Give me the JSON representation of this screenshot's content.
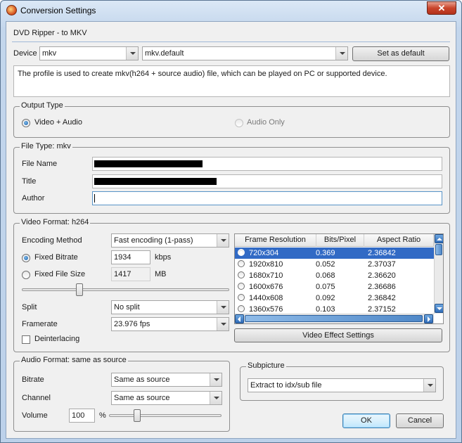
{
  "window": {
    "title": "Conversion Settings",
    "close_glyph": "✕"
  },
  "header": {
    "title": "DVD Ripper - to MKV"
  },
  "device": {
    "label": "Device",
    "device_value": "mkv",
    "profile_value": "mkv.default",
    "set_default_label": "Set as default",
    "description": "The profile is used to create mkv(h264 + source audio) file, which can be played on PC or supported device."
  },
  "output_type": {
    "label": "Output Type",
    "video_audio": "Video + Audio",
    "audio_only": "Audio Only",
    "selected": "Video + Audio"
  },
  "file_type": {
    "label": "File Type: mkv",
    "file_name_label": "File Name",
    "title_label": "Title",
    "author_label": "Author"
  },
  "video": {
    "label": "Video Format: h264",
    "encoding_label": "Encoding Method",
    "encoding_value": "Fast encoding (1-pass)",
    "fixed_bitrate_label": "Fixed Bitrate",
    "bitrate_value": "1934",
    "bitrate_unit": "kbps",
    "fixed_size_label": "Fixed File Size",
    "size_value": "1417",
    "size_unit": "MB",
    "rate_mode": "Fixed Bitrate",
    "quality_slider_fraction": 0.27,
    "split_label": "Split",
    "split_value": "No split",
    "framerate_label": "Framerate",
    "framerate_value": "23.976 fps",
    "deinterlacing_label": "Deinterlacing",
    "deinterlacing_checked": false,
    "effect_settings_label": "Video Effect Settings",
    "table": {
      "headers": [
        "Frame Resolution",
        "Bits/Pixel",
        "Aspect Ratio"
      ],
      "rows": [
        {
          "resolution": "720x304",
          "bits": "0.369",
          "aspect": "2.36842",
          "selected": true
        },
        {
          "resolution": "1920x810",
          "bits": "0.052",
          "aspect": "2.37037",
          "selected": false
        },
        {
          "resolution": "1680x710",
          "bits": "0.068",
          "aspect": "2.36620",
          "selected": false
        },
        {
          "resolution": "1600x676",
          "bits": "0.075",
          "aspect": "2.36686",
          "selected": false
        },
        {
          "resolution": "1440x608",
          "bits": "0.092",
          "aspect": "2.36842",
          "selected": false
        },
        {
          "resolution": "1360x576",
          "bits": "0.103",
          "aspect": "2.37152",
          "selected": false
        }
      ]
    }
  },
  "audio": {
    "label": "Audio Format: same as source",
    "bitrate_label": "Bitrate",
    "bitrate_value": "Same as source",
    "channel_label": "Channel",
    "channel_value": "Same as source",
    "volume_label": "Volume",
    "volume_value": "100",
    "volume_unit": "%",
    "volume_slider_fraction": 0.23
  },
  "subpicture": {
    "label": "Subpicture",
    "value": "Extract to idx/sub file"
  },
  "footer": {
    "ok_label": "OK",
    "cancel_label": "Cancel"
  }
}
